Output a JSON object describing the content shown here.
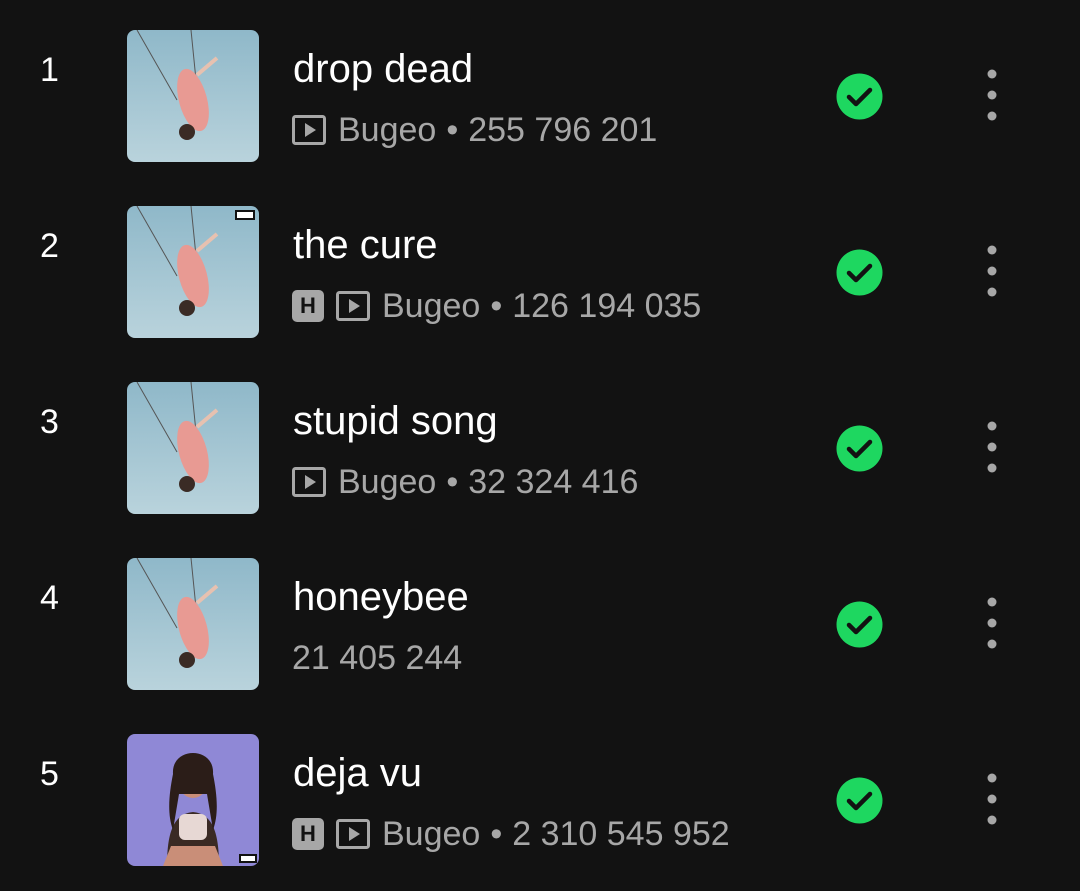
{
  "tracks": [
    {
      "index": "1",
      "title": "drop dead",
      "explicit": false,
      "video": true,
      "artist": "Bugeo",
      "separator": "•",
      "plays": "255 796 201",
      "downloaded": true,
      "cover": "sky"
    },
    {
      "index": "2",
      "title": "the cure",
      "explicit": true,
      "explicit_label": "H",
      "video": true,
      "artist": "Bugeo",
      "separator": "•",
      "plays": "126 194 035",
      "downloaded": true,
      "cover": "sky"
    },
    {
      "index": "3",
      "title": "stupid song",
      "explicit": false,
      "video": true,
      "artist": "Bugeo",
      "separator": "•",
      "plays": "32 324 416",
      "downloaded": true,
      "cover": "sky"
    },
    {
      "index": "4",
      "title": "honeybee",
      "explicit": false,
      "video": false,
      "artist": "",
      "separator": "",
      "plays": "21 405 244",
      "downloaded": true,
      "cover": "sky"
    },
    {
      "index": "5",
      "title": "deja vu",
      "explicit": true,
      "explicit_label": "H",
      "video": true,
      "artist": "Bugeo",
      "separator": "•",
      "plays": "2 310 545 952",
      "downloaded": true,
      "cover": "purple"
    }
  ],
  "colors": {
    "background": "#121212",
    "text_primary": "#ffffff",
    "text_secondary": "#a7a7a7",
    "download_green": "#1ed760"
  },
  "icons": {
    "download_status": "check-circle-icon",
    "more_options": "more-vertical-icon",
    "video": "video-play-icon",
    "explicit": "explicit-badge-icon"
  }
}
